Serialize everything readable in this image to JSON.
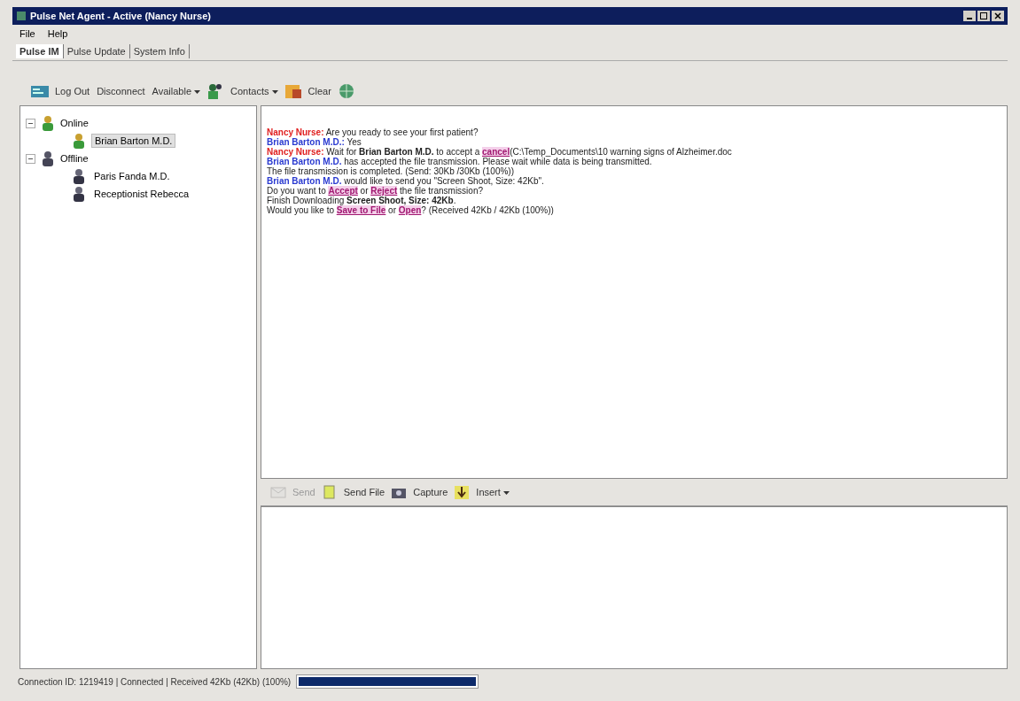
{
  "window": {
    "title": "Pulse Net Agent - Active (Nancy Nurse)"
  },
  "menu": [
    "File",
    "Help"
  ],
  "tabs": [
    {
      "label": "Pulse IM",
      "selected": true
    },
    {
      "label": "Pulse Update",
      "selected": false
    },
    {
      "label": "System Info",
      "selected": false
    }
  ],
  "toolbar": [
    {
      "kind": "logout",
      "label": "Log Out"
    },
    {
      "kind": "plain",
      "label": "Disconnect"
    },
    {
      "kind": "dropdown",
      "label": "Available"
    },
    {
      "kind": "contacts",
      "label": "Contacts"
    },
    {
      "kind": "clear",
      "label": "Clear"
    },
    {
      "kind": "globe"
    }
  ],
  "contacts": [
    {
      "label": "Online",
      "kind": "online",
      "expanded": true,
      "children": [
        {
          "label": "Brian Barton M.D.",
          "kind": "online",
          "selected": true
        }
      ]
    },
    {
      "label": "Offline",
      "kind": "offline",
      "expanded": true,
      "children": [
        {
          "label": "Paris Fanda M.D.",
          "kind": "offline",
          "selected": false
        },
        {
          "label": "Receptionist Rebecca",
          "kind": "offline",
          "selected": false
        }
      ]
    }
  ],
  "messages": [
    [
      {
        "kind": "me",
        "text": "Nancy Nurse:"
      },
      {
        "kind": "text",
        "text": " Are you ready to see your first patient?"
      }
    ],
    [
      {
        "kind": "peer",
        "text": "Brian Barton M.D.:"
      },
      {
        "kind": "text",
        "text": " Yes"
      }
    ],
    [
      {
        "kind": "me",
        "text": "Nancy Nurse:"
      },
      {
        "kind": "text",
        "text": " Wait for "
      },
      {
        "kind": "bold",
        "text": "Brian Barton M.D."
      },
      {
        "kind": "text",
        "text": " to accept a "
      },
      {
        "kind": "link",
        "text": "cancel"
      },
      {
        "kind": "text",
        "text": "(C:\\Temp_Documents\\10 warning signs of Alzheimer.doc"
      }
    ],
    [
      {
        "kind": "peer",
        "text": "Brian Barton M.D."
      },
      {
        "kind": "text",
        "text": " has accepted the file transmission. Please wait while data is being transmitted."
      }
    ],
    [
      {
        "kind": "text",
        "text": "The file transmission is completed. (Send: 30Kb /30Kb (100%))"
      }
    ],
    [
      {
        "kind": "peer",
        "text": "Brian Barton M.D."
      },
      {
        "kind": "text",
        "text": " would like to send you \"Screen Shoot, Size: 42Kb\"."
      }
    ],
    [
      {
        "kind": "text",
        "text": "Do you want to "
      },
      {
        "kind": "link",
        "text": "Accept"
      },
      {
        "kind": "text",
        "text": " or "
      },
      {
        "kind": "link",
        "text": "Reject"
      },
      {
        "kind": "text",
        "text": " the file transmission?"
      }
    ],
    [
      {
        "kind": "text",
        "text": "Finish Downloading "
      },
      {
        "kind": "bold",
        "text": "Screen Shoot, Size: 42Kb"
      },
      {
        "kind": "text",
        "text": "."
      }
    ],
    [
      {
        "kind": "text",
        "text": "Would you like to "
      },
      {
        "kind": "link",
        "text": "Save to File"
      },
      {
        "kind": "text",
        "text": " or "
      },
      {
        "kind": "link",
        "text": "Open"
      },
      {
        "kind": "text",
        "text": "? (Received 42Kb / 42Kb (100%))"
      }
    ]
  ],
  "compose_toolbar": [
    {
      "kind": "send",
      "label": "Send",
      "disabled": true
    },
    {
      "kind": "file",
      "label": "Send File",
      "disabled": false
    },
    {
      "kind": "camera",
      "label": "Capture",
      "disabled": false
    },
    {
      "kind": "insert",
      "label": "Insert",
      "disabled": false
    }
  ],
  "status_bar": {
    "text": "Connection ID: 1219419 | Connected | Received 42Kb (42Kb) (100%)",
    "level": 1
  }
}
